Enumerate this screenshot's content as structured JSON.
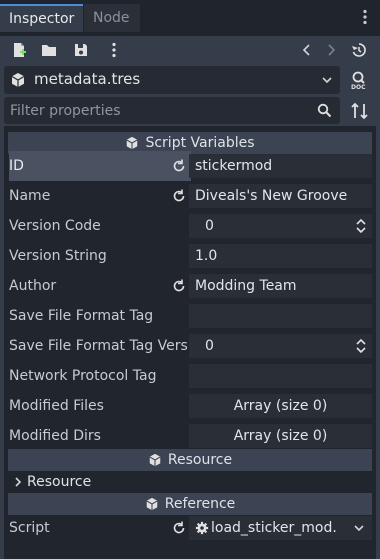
{
  "tabs": [
    {
      "label": "Inspector",
      "active": true
    },
    {
      "label": "Node",
      "active": false
    }
  ],
  "toolbar": {
    "icons": [
      "new-resource-icon",
      "open-folder-icon",
      "save-icon",
      "more-vertical-icon",
      "back-arrow-icon",
      "forward-arrow-icon",
      "history-icon"
    ]
  },
  "resource": {
    "name": "metadata.tres"
  },
  "filter": {
    "placeholder": "Filter properties"
  },
  "sections": {
    "script_variables": "Script Variables",
    "resource": "Resource",
    "reference": "Reference"
  },
  "properties": [
    {
      "label": "ID",
      "value": "stickermod",
      "revert": true,
      "selected": true
    },
    {
      "label": "Name",
      "value": "Diveals's New Groove",
      "revert": true
    },
    {
      "label": "Version Code",
      "value": "0",
      "spin": true
    },
    {
      "label": "Version String",
      "value": "1.0"
    },
    {
      "label": "Author",
      "value": "Modding Team",
      "revert": true
    },
    {
      "label": "Save File Format Tag",
      "value": ""
    },
    {
      "label": "Save File Format Tag Versi",
      "value": "0",
      "spin": true
    },
    {
      "label": "Network Protocol Tag",
      "value": ""
    },
    {
      "label": "Modified Files",
      "value": "Array (size 0)"
    },
    {
      "label": "Modified Dirs",
      "value": "Array (size 0)"
    }
  ],
  "resource_group": {
    "label": "Resource"
  },
  "script": {
    "label": "Script",
    "value": "load_sticker_mod."
  },
  "colors": {
    "accent": "#4d8bd9",
    "background": "#363d4a",
    "panel": "#21252d"
  }
}
